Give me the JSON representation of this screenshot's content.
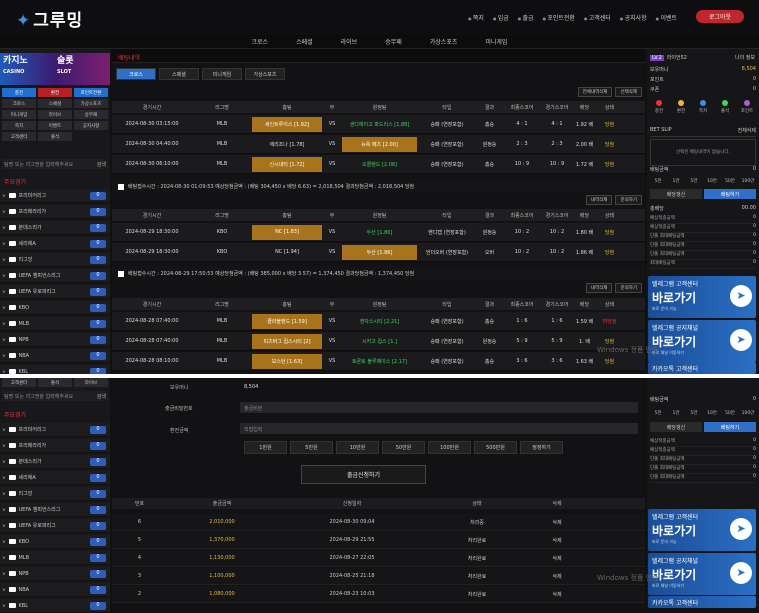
{
  "header": {
    "logo": "그루밍",
    "links": [
      "쪽지",
      "입금",
      "출금",
      "포인트전환",
      "고객센터",
      "공지사항",
      "이벤트"
    ],
    "logout": "로그아웃"
  },
  "nav": [
    "크로스",
    "스페셜",
    "라이브",
    "승무패",
    "가상스포츠",
    "미니게임"
  ],
  "left": {
    "banner_casino": "카지노",
    "banner_casino_sub": "CASINO",
    "banner_slot": "슬롯",
    "banner_slot_sub": "SLOT",
    "buttons": [
      "충전",
      "환전",
      "포인트전환",
      "크로스",
      "스페셜",
      "가상스포츠",
      "미니게임",
      "라이브",
      "승무패",
      "쪽지",
      "이벤트",
      "공지사항",
      "고객센터",
      "출석"
    ],
    "search_placeholder": "팀명 또는 리그명을 입력해주세요",
    "search_btn": "검색",
    "section": "주요경기",
    "leagues": [
      "프리미어리그",
      "프리메라리가",
      "분데스리가",
      "세리에A",
      "리그앙",
      "UEFA 챔피언스리그",
      "UEFA 유로파리그",
      "KBO",
      "MLB",
      "NPB",
      "NBA",
      "KBL"
    ],
    "counts": [
      "0",
      "0",
      "0",
      "0",
      "0",
      "0",
      "0",
      "0",
      "0",
      "0",
      "0",
      "0"
    ]
  },
  "center": {
    "title": "배팅내역",
    "tabs": [
      "크로스",
      "스페셜",
      "미니게임",
      "가상스포츠"
    ],
    "top_btns": [
      "전체내역삭제",
      "선택삭제"
    ],
    "columns": [
      "경기시간",
      "리그명",
      "홈팀",
      "무",
      "원정팀",
      "타입",
      "결과",
      "최종스코어",
      "경기스코어",
      "배당",
      "상태"
    ],
    "group1": [
      {
        "date": "2024-08-30 03:15:00",
        "league": "MLB",
        "home": "세인트루이스 [1.92]",
        "vs": "VS",
        "away": "샌디에이고 파드리스 [1.88]",
        "type": "승패 (연장포함)",
        "res": "홈승",
        "s1": "4 : 1",
        "s2": "4 : 1",
        "odd": "1.92 배",
        "st": "당첨"
      },
      {
        "date": "2024-08-30 04:40:00",
        "league": "MLB",
        "home": "애리조나 [1.78]",
        "vs": "VS",
        "away": "뉴욕 메츠 [2.00]",
        "type": "승패 (연장포함)",
        "res": "원정승",
        "s1": "2 : 3",
        "s2": "2 : 3",
        "odd": "2.00 배",
        "st": "당첨"
      },
      {
        "date": "2024-08-30 06:10:00",
        "league": "MLB",
        "home": "신시내티 [1.72]",
        "vs": "VS",
        "away": "오클랜드 [2.08]",
        "type": "승패 (연장포함)",
        "res": "홈승",
        "s1": "10 : 9",
        "s2": "10 : 9",
        "odd": "1.72 배",
        "st": "당첨"
      }
    ],
    "summary1": "배팅접수시간 : 2024-08-30 01:09:53 예상당첨금액 : (배팅 304,450 x 배당 6.63) = 2,018,504 결과당첨금액 : 2,018,504 당첨",
    "mid_btns": [
      "내역삭제",
      "문의하기"
    ],
    "group2": [
      {
        "date": "2024-08-29 18:30:00",
        "league": "KBO",
        "home": "NC [1.83]",
        "vs": "VS",
        "away": "두산 [1.80]",
        "type": "핸디캡 (연장포함)",
        "res": "원정승",
        "s1": "10 : 2",
        "s2": "10 : 2",
        "odd": "1.80 배",
        "st": "당첨"
      },
      {
        "date": "2024-08-29 18:30:00",
        "league": "KBO",
        "home": "NC [1.94]",
        "vs": "VS",
        "away": "두산 [1.86]",
        "type": "언더오버 (연장포함)",
        "res": "오버",
        "s1": "10 : 2",
        "s2": "10 : 2",
        "odd": "1.86 배",
        "st": "당첨"
      }
    ],
    "summary2": "배팅접수시간 : 2024-08-29 17:50:53 예상당첨금액 : (배팅 385,000 x 배당 3.57) = 1,374,450 결과당첨금액 : 1,374,450 당첨",
    "group3": [
      {
        "date": "2024-08-28 07:40:00",
        "league": "MLB",
        "home": "클리블랜드 [1.59]",
        "vs": "VS",
        "away": "캔자스시티 [2.21]",
        "type": "승패 (연장포함)",
        "res": "홈승",
        "s1": "1 : 6",
        "s2": "1 : 6",
        "odd": "1.59 배",
        "st": "미당첨"
      },
      {
        "date": "2024-08-28 07:40:00",
        "league": "MLB",
        "home": "피츠버그 컵스시티 [2]",
        "vs": "VS",
        "away": "시카고 컵스 [1.]",
        "type": "승패 (연장포함)",
        "res": "원정승",
        "s1": "5 : 9",
        "s2": "5 : 9",
        "odd": "1. 배",
        "st": "당첨"
      },
      {
        "date": "2024-08-28 08:10:00",
        "league": "MLB",
        "home": "보스턴 [1.63]",
        "vs": "VS",
        "away": "토론토 블루제이스 [2.17]",
        "type": "승패 (연장포함)",
        "res": "홈승",
        "s1": "3 : 6",
        "s2": "3 : 6",
        "odd": "1.63 배",
        "st": "당첨"
      }
    ]
  },
  "right": {
    "level": "LV.2",
    "user": "라이언52",
    "nav": "나의 정보",
    "money_label": "보유머니",
    "money": "8,504",
    "point_label": "포인트",
    "point": "0",
    "coupon_label": "쿠폰",
    "coupon": "0",
    "icons": [
      "충전",
      "환전",
      "쪽지",
      "출석",
      "포인트"
    ],
    "betslip": "BET SLIP",
    "betslip_all": "전체삭제",
    "slip_empty": "선택된 배팅내역이 없습니다.",
    "bet_label": "배팅금액",
    "bet_value": "0",
    "amts": [
      "5천",
      "1만",
      "5만",
      "10만",
      "50만",
      "100만"
    ],
    "tab1": "배당갱신",
    "tab2": "배팅하기",
    "total_odds_label": "총배당",
    "total_odds": "00.00",
    "items": [
      "예상적중금액",
      "예상적중금액",
      "단폴 최대배팅금액",
      "단폴 최대배팅금액",
      "단폴 최대배팅금액",
      "최대배팅금액"
    ],
    "items_val": [
      "0",
      "0",
      "0",
      "0",
      "0",
      "0"
    ],
    "tg1_t1": "텔레그램 고객센터",
    "tg1_t2": "바로가기",
    "tg1_t3": "바로 문의 가능",
    "tg2_t1": "텔레그램 공지채널",
    "tg2_t2": "바로가기",
    "tg2_t3": "바로 채널 이동하기",
    "kakao": "카카오톡 고객센터"
  },
  "withdraw": {
    "money_label": "보유머니",
    "money": "8,504",
    "account_label": "출금비밀번호",
    "account_placeholder": "출금비번",
    "amount_label": "환전금액",
    "amount_placeholder": "직접입력",
    "amts": [
      "1만원",
      "5만원",
      "10만원",
      "50만원",
      "100만원",
      "500만원",
      "정정하기"
    ],
    "submit": "출금신청하기",
    "hist_cols": [
      "번호",
      "출금금액",
      "신청일자",
      "상태",
      "삭제"
    ],
    "hist": [
      {
        "no": "6",
        "amt": "2,010,000",
        "date": "2024-08-30 09:04",
        "st": "처리중",
        "del": "삭제"
      },
      {
        "no": "5",
        "amt": "1,370,000",
        "date": "2024-08-29 21:55",
        "st": "처리완료",
        "del": "삭제"
      },
      {
        "no": "4",
        "amt": "1,130,000",
        "date": "2024-08-27 22:05",
        "st": "처리완료",
        "del": "삭제"
      },
      {
        "no": "3",
        "amt": "1,100,000",
        "date": "2024-08-25 21:18",
        "st": "처리완료",
        "del": "삭제"
      },
      {
        "no": "2",
        "amt": "1,080,000",
        "date": "2024-08-23 10:03",
        "st": "처리완료",
        "del": "삭제"
      }
    ]
  },
  "watermark": "Windows 정품 인증"
}
